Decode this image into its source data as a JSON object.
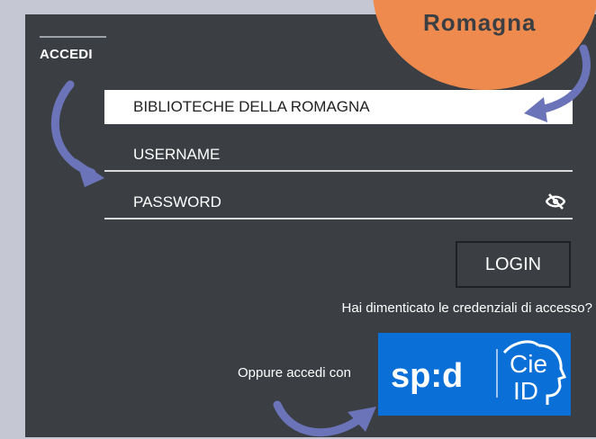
{
  "badge": {
    "label": "Romagna"
  },
  "panel": {
    "title": "ACCEDI"
  },
  "form": {
    "library_value": "BIBLIOTECHE DELLA ROMAGNA",
    "username_label": "USERNAME",
    "password_label": "PASSWORD",
    "login_label": "LOGIN",
    "forgot_link": "Hai dimenticato le credenziali di accesso?",
    "alt_login_label": "Oppure accedi con"
  },
  "spid_cie": {
    "spid_text": "sp:d",
    "cie_top": "Cie",
    "cie_bottom": "ID"
  },
  "icons": {
    "password_toggle": "eye-slash-icon",
    "arrows": [
      "curved-arrow-icon",
      "curved-arrow-icon",
      "curved-arrow-icon"
    ]
  },
  "colors": {
    "panel": "#3b3f44",
    "page": "#c5c8d3",
    "badge": "#ee8a4e",
    "arrow": "#6b74b8",
    "spid_cie": "#0b6fd8"
  }
}
